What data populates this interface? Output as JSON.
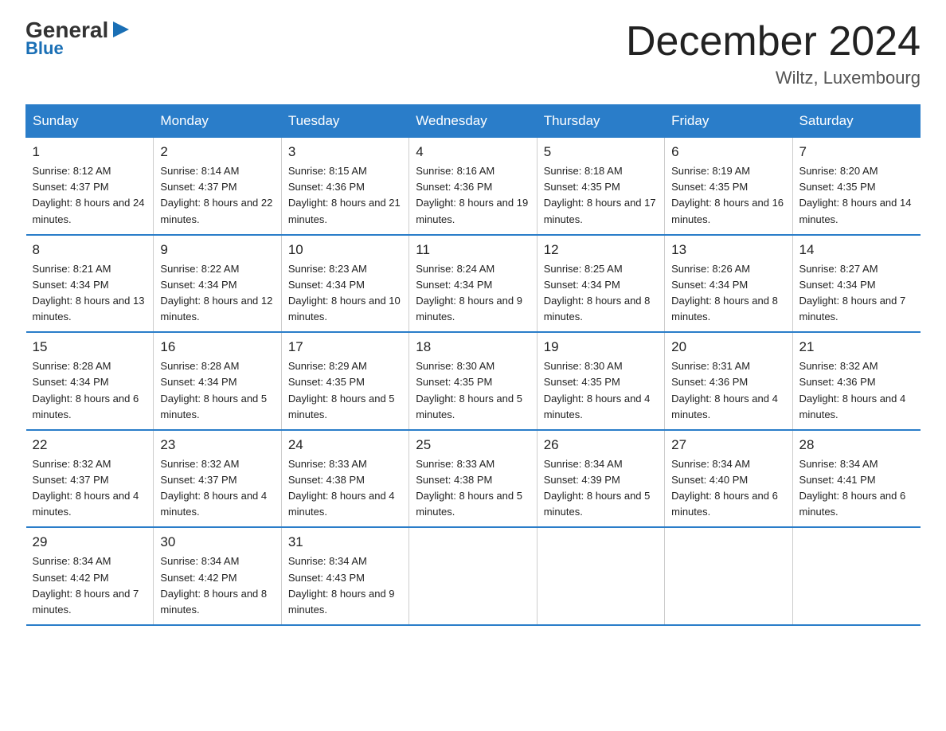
{
  "header": {
    "logo_general": "General",
    "logo_blue": "Blue",
    "month_title": "December 2024",
    "location": "Wiltz, Luxembourg"
  },
  "weekdays": [
    "Sunday",
    "Monday",
    "Tuesday",
    "Wednesday",
    "Thursday",
    "Friday",
    "Saturday"
  ],
  "weeks": [
    [
      {
        "day": "1",
        "sunrise": "8:12 AM",
        "sunset": "4:37 PM",
        "daylight": "8 hours and 24 minutes."
      },
      {
        "day": "2",
        "sunrise": "8:14 AM",
        "sunset": "4:37 PM",
        "daylight": "8 hours and 22 minutes."
      },
      {
        "day": "3",
        "sunrise": "8:15 AM",
        "sunset": "4:36 PM",
        "daylight": "8 hours and 21 minutes."
      },
      {
        "day": "4",
        "sunrise": "8:16 AM",
        "sunset": "4:36 PM",
        "daylight": "8 hours and 19 minutes."
      },
      {
        "day": "5",
        "sunrise": "8:18 AM",
        "sunset": "4:35 PM",
        "daylight": "8 hours and 17 minutes."
      },
      {
        "day": "6",
        "sunrise": "8:19 AM",
        "sunset": "4:35 PM",
        "daylight": "8 hours and 16 minutes."
      },
      {
        "day": "7",
        "sunrise": "8:20 AM",
        "sunset": "4:35 PM",
        "daylight": "8 hours and 14 minutes."
      }
    ],
    [
      {
        "day": "8",
        "sunrise": "8:21 AM",
        "sunset": "4:34 PM",
        "daylight": "8 hours and 13 minutes."
      },
      {
        "day": "9",
        "sunrise": "8:22 AM",
        "sunset": "4:34 PM",
        "daylight": "8 hours and 12 minutes."
      },
      {
        "day": "10",
        "sunrise": "8:23 AM",
        "sunset": "4:34 PM",
        "daylight": "8 hours and 10 minutes."
      },
      {
        "day": "11",
        "sunrise": "8:24 AM",
        "sunset": "4:34 PM",
        "daylight": "8 hours and 9 minutes."
      },
      {
        "day": "12",
        "sunrise": "8:25 AM",
        "sunset": "4:34 PM",
        "daylight": "8 hours and 8 minutes."
      },
      {
        "day": "13",
        "sunrise": "8:26 AM",
        "sunset": "4:34 PM",
        "daylight": "8 hours and 8 minutes."
      },
      {
        "day": "14",
        "sunrise": "8:27 AM",
        "sunset": "4:34 PM",
        "daylight": "8 hours and 7 minutes."
      }
    ],
    [
      {
        "day": "15",
        "sunrise": "8:28 AM",
        "sunset": "4:34 PM",
        "daylight": "8 hours and 6 minutes."
      },
      {
        "day": "16",
        "sunrise": "8:28 AM",
        "sunset": "4:34 PM",
        "daylight": "8 hours and 5 minutes."
      },
      {
        "day": "17",
        "sunrise": "8:29 AM",
        "sunset": "4:35 PM",
        "daylight": "8 hours and 5 minutes."
      },
      {
        "day": "18",
        "sunrise": "8:30 AM",
        "sunset": "4:35 PM",
        "daylight": "8 hours and 5 minutes."
      },
      {
        "day": "19",
        "sunrise": "8:30 AM",
        "sunset": "4:35 PM",
        "daylight": "8 hours and 4 minutes."
      },
      {
        "day": "20",
        "sunrise": "8:31 AM",
        "sunset": "4:36 PM",
        "daylight": "8 hours and 4 minutes."
      },
      {
        "day": "21",
        "sunrise": "8:32 AM",
        "sunset": "4:36 PM",
        "daylight": "8 hours and 4 minutes."
      }
    ],
    [
      {
        "day": "22",
        "sunrise": "8:32 AM",
        "sunset": "4:37 PM",
        "daylight": "8 hours and 4 minutes."
      },
      {
        "day": "23",
        "sunrise": "8:32 AM",
        "sunset": "4:37 PM",
        "daylight": "8 hours and 4 minutes."
      },
      {
        "day": "24",
        "sunrise": "8:33 AM",
        "sunset": "4:38 PM",
        "daylight": "8 hours and 4 minutes."
      },
      {
        "day": "25",
        "sunrise": "8:33 AM",
        "sunset": "4:38 PM",
        "daylight": "8 hours and 5 minutes."
      },
      {
        "day": "26",
        "sunrise": "8:34 AM",
        "sunset": "4:39 PM",
        "daylight": "8 hours and 5 minutes."
      },
      {
        "day": "27",
        "sunrise": "8:34 AM",
        "sunset": "4:40 PM",
        "daylight": "8 hours and 6 minutes."
      },
      {
        "day": "28",
        "sunrise": "8:34 AM",
        "sunset": "4:41 PM",
        "daylight": "8 hours and 6 minutes."
      }
    ],
    [
      {
        "day": "29",
        "sunrise": "8:34 AM",
        "sunset": "4:42 PM",
        "daylight": "8 hours and 7 minutes."
      },
      {
        "day": "30",
        "sunrise": "8:34 AM",
        "sunset": "4:42 PM",
        "daylight": "8 hours and 8 minutes."
      },
      {
        "day": "31",
        "sunrise": "8:34 AM",
        "sunset": "4:43 PM",
        "daylight": "8 hours and 9 minutes."
      },
      null,
      null,
      null,
      null
    ]
  ]
}
